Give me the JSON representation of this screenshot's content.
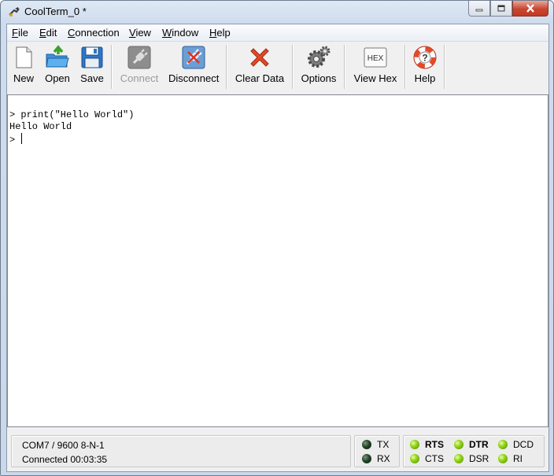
{
  "window": {
    "title": "CoolTerm_0 *"
  },
  "menu": [
    {
      "key": "F",
      "rest": "ile"
    },
    {
      "key": "E",
      "rest": "dit"
    },
    {
      "key": "C",
      "rest": "onnection"
    },
    {
      "key": "V",
      "rest": "iew"
    },
    {
      "key": "W",
      "rest": "indow"
    },
    {
      "key": "H",
      "rest": "elp"
    }
  ],
  "toolbar": {
    "new": "New",
    "open": "Open",
    "save": "Save",
    "connect": "Connect",
    "disconnect": "Disconnect",
    "clear_data": "Clear Data",
    "options": "Options",
    "view_hex": "View Hex",
    "hex_badge": "HEX",
    "help": "Help"
  },
  "terminal": {
    "lines": [
      "> print(\"Hello World\")",
      "Hello World",
      "> "
    ]
  },
  "status": {
    "port": "COM7 / 9600 8-N-1",
    "connection": "Connected 00:03:35",
    "leds": {
      "tx": "TX",
      "rx": "RX",
      "rts": "RTS",
      "cts": "CTS",
      "dtr": "DTR",
      "dsr": "DSR",
      "dcd": "DCD",
      "ri": "RI"
    }
  },
  "colors": {
    "led_on": "#8ccc1a",
    "led_off": "#1d3a22",
    "close_button": "#c8462f"
  }
}
